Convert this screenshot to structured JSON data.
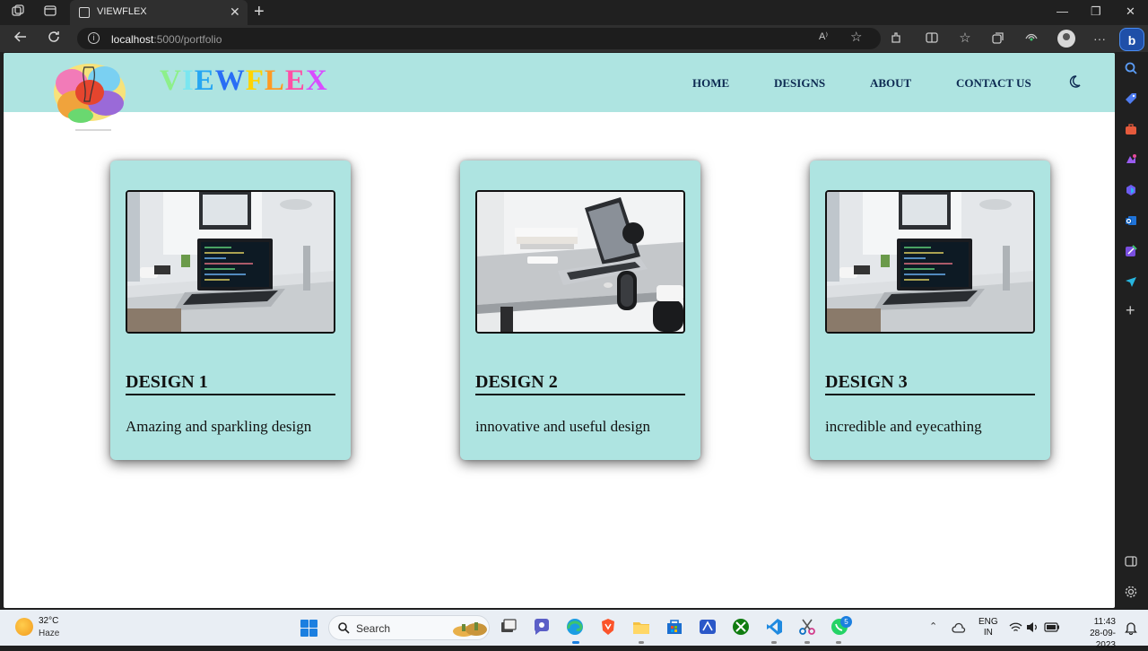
{
  "browser": {
    "tab_title": "VIEWFLEX",
    "url_host": "localhost",
    "url_rest": ":5000/portfolio",
    "accent": "#1f4fa8"
  },
  "site": {
    "brand_letters": [
      "V",
      "I",
      "E",
      "W",
      "F",
      "L",
      "E",
      "X"
    ],
    "nav": [
      "HOME",
      "DESIGNS",
      "ABOUT",
      "CONTACT US"
    ],
    "header_color": "#aee4e1"
  },
  "cards": [
    {
      "title": "DESIGN 1",
      "description": "Amazing and sparkling design",
      "image": "laptop-desk-photo"
    },
    {
      "title": "DESIGN 2",
      "description": "innovative and useful design",
      "image": "laptop-desk-angle-photo"
    },
    {
      "title": "DESIGN 3",
      "description": "incredible and eyecathing",
      "image": "laptop-desk-photo"
    }
  ],
  "taskbar": {
    "temperature": "32°C",
    "weather": "Haze",
    "search_label": "Search",
    "whatsapp_badge": "5",
    "lang_line1": "ENG",
    "lang_line2": "IN",
    "time": "11:43",
    "date": "28-09-2023"
  }
}
